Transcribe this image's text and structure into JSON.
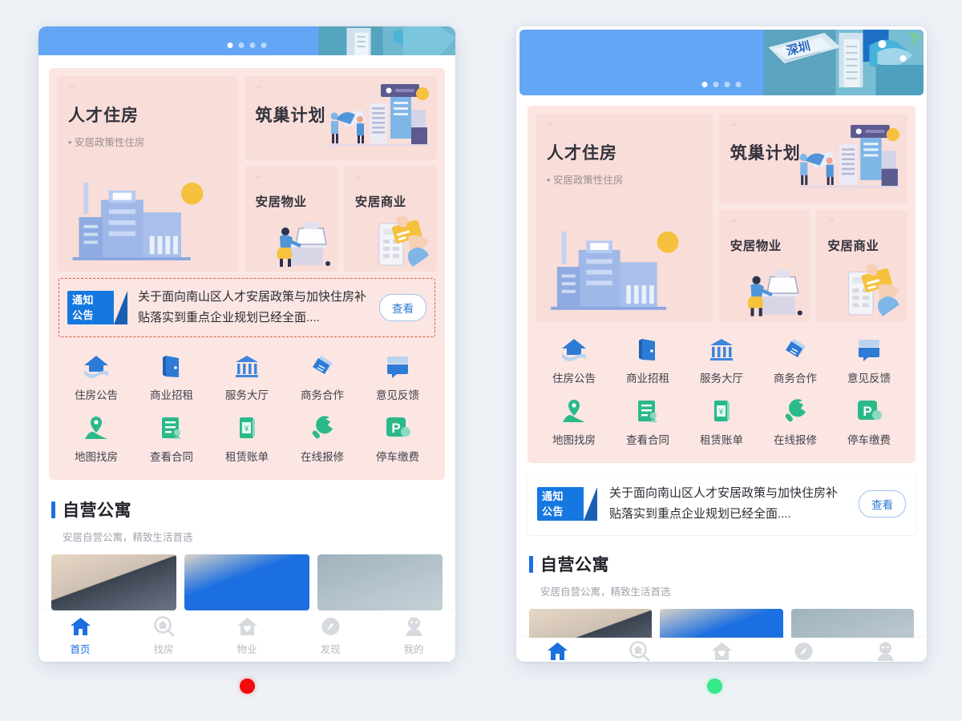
{
  "page": {
    "background_color": "#eef2f7",
    "accent_blue": "#1b6fe0",
    "pink_panel_color": "#fbe6e3",
    "card_pink_color": "#f9ddd9"
  },
  "banner": {
    "name": "hero-carousel",
    "background_color": "#63a6f5",
    "illustration_text": "深圳",
    "dots": [
      {
        "active": true
      },
      {
        "active": false
      },
      {
        "active": false
      },
      {
        "active": false
      }
    ]
  },
  "entries": {
    "talent_housing": {
      "quote_mark": "“",
      "title": "人才住房",
      "subtitle": "• 安居政策性住房",
      "illustration": "city-buildings-sun"
    },
    "nest_plan": {
      "quote_mark": "“",
      "title": "筑巢计划",
      "illustration": "people-chart-board"
    },
    "property": {
      "quote_mark": "“",
      "title": "安居物业",
      "illustration": "person-at-desk"
    },
    "commerce": {
      "quote_mark": "“",
      "title": "安居商业",
      "illustration": "hand-card-pos"
    }
  },
  "icon_grid": {
    "rows": [
      [
        {
          "label": "住房公告",
          "icon": "house-hand-icon",
          "color": "#2e7bd6"
        },
        {
          "label": "商业招租",
          "icon": "door-icon",
          "color": "#2e7bd6"
        },
        {
          "label": "服务大厅",
          "icon": "bank-icon",
          "color": "#3d86dd"
        },
        {
          "label": "商务合作",
          "icon": "handshake-icon",
          "color": "#2e7bd6"
        },
        {
          "label": "意见反馈",
          "icon": "feedback-icon",
          "color": "#2e7bd6"
        }
      ],
      [
        {
          "label": "地图找房",
          "icon": "map-pin-icon",
          "color": "#2bb98a"
        },
        {
          "label": "查看合同",
          "icon": "contract-icon",
          "color": "#2bb98a"
        },
        {
          "label": "租赁账单",
          "icon": "bill-yuan-icon",
          "color": "#2bb98a"
        },
        {
          "label": "在线报修",
          "icon": "wrench-icon",
          "color": "#2bb98a"
        },
        {
          "label": "停车缴费",
          "icon": "parking-icon",
          "color": "#2bb98a"
        }
      ]
    ]
  },
  "notice": {
    "badge_line1": "通知",
    "badge_line2": "公告",
    "text": "关于面向南山区人才安居政策与加快住房补贴落实到重点企业规划已经全面....",
    "button_label": "查看",
    "badge_color": "#1677e0"
  },
  "section": {
    "title": "自营公寓",
    "subtitle": "安居自营公寓，精致生活首选"
  },
  "tabbar": {
    "tabs": [
      {
        "label": "首页",
        "icon": "home-icon",
        "active": true
      },
      {
        "label": "找房",
        "icon": "search-house-icon",
        "active": false
      },
      {
        "label": "物业",
        "icon": "house-heart-icon",
        "active": false
      },
      {
        "label": "发现",
        "icon": "compass-icon",
        "active": false
      },
      {
        "label": "我的",
        "icon": "person-icon",
        "active": false
      }
    ]
  },
  "status_dots": [
    {
      "name": "red-status-dot",
      "color": "#f10b0b"
    },
    {
      "name": "green-status-dot",
      "color": "#35e888"
    }
  ]
}
